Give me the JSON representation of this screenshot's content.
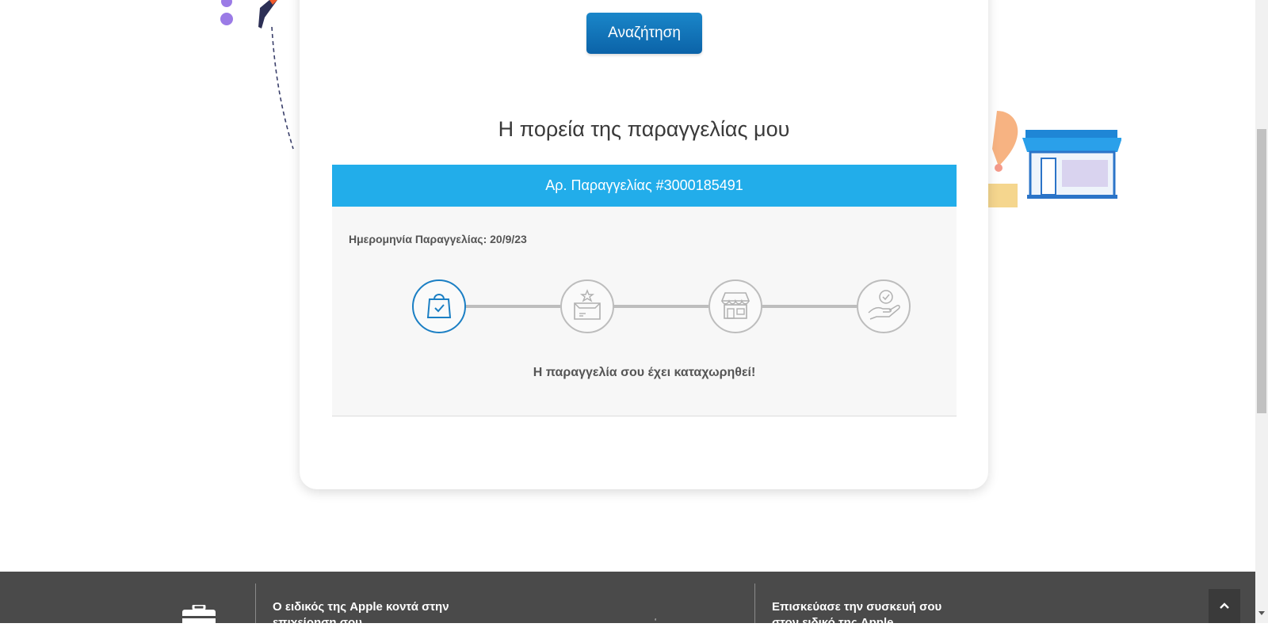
{
  "search": {
    "button_label": "Αναζήτηση"
  },
  "tracking": {
    "section_title": "Η πορεία της παραγγελίας μου",
    "order_header": "Αρ. Παραγγελίας #3000185491",
    "order_date": "Ημερομηνία Παραγγελίας: 20/9/23",
    "status_message": "Η παραγγελία σου έχει καταχωρηθεί!",
    "steps": [
      {
        "icon": "shopping-bag-check-icon",
        "state": "active"
      },
      {
        "icon": "package-box-icon",
        "state": "inactive"
      },
      {
        "icon": "store-icon",
        "state": "inactive"
      },
      {
        "icon": "hand-delivery-check-icon",
        "state": "inactive"
      }
    ]
  },
  "footer": {
    "col1_text": "Ο ειδικός της Apple κοντά στην επιχείρηση σου",
    "col2_text": "Επισκεύασε την συσκευή σου στον ειδικό της Apple",
    "back_to_top_icon": "chevron-up-icon"
  },
  "colors": {
    "accent_blue": "#22adea",
    "button_blue": "#0b63a8",
    "active_step": "#1b7fc4",
    "footer_bg": "#4a4a4a"
  }
}
